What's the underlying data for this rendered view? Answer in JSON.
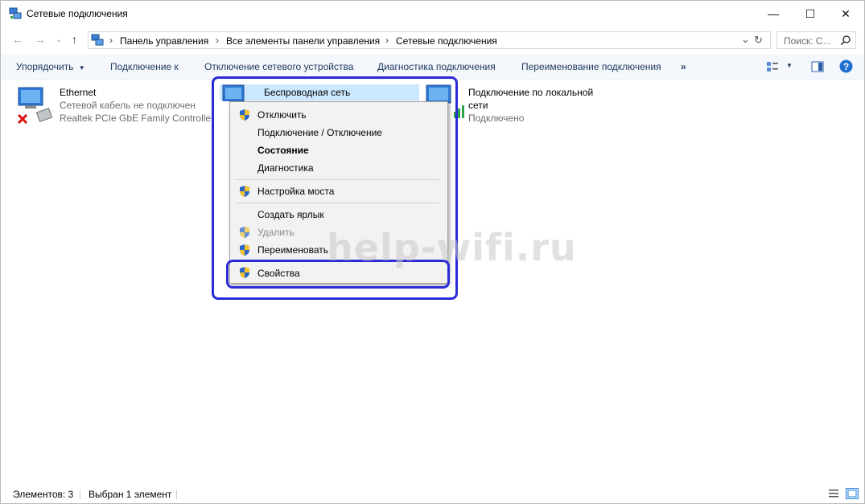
{
  "window": {
    "title": "Сетевые подключения",
    "controls": {
      "minimize": "—",
      "maximize": "☐",
      "close": "✕"
    }
  },
  "address": {
    "breadcrumbs": [
      "Панель управления",
      "Все элементы панели управления",
      "Сетевые подключения"
    ],
    "search_placeholder": "Поиск: С...",
    "nav_back": "←",
    "nav_forward": "→",
    "nav_up": "↑",
    "dropdown": "⌄",
    "refresh": "↻"
  },
  "toolbar": {
    "items": [
      "Упорядочить",
      "Подключение к",
      "Отключение сетевого устройства",
      "Диагностика подключения",
      "Переименование подключения"
    ],
    "more": "»"
  },
  "connections": [
    {
      "name": "Ethernet",
      "line1": "Сетевой кабель не подключен",
      "line2": "Realtek PCIe GbE Family Controller"
    },
    {
      "name": "Беспроводная сеть"
    },
    {
      "name": "Подключение по локальной",
      "name2": "сети",
      "line1": "Подключено"
    }
  ],
  "context_menu": {
    "items": [
      "Отключить",
      "Подключение / Отключение",
      "Состояние",
      "Диагностика",
      "Настройка моста",
      "Создать ярлык",
      "Удалить",
      "Переименовать",
      "Свойства"
    ]
  },
  "watermark": "help-wifi.ru",
  "status": {
    "count": "Элементов: 3",
    "selected": "Выбран 1 элемент"
  },
  "colors": {
    "accent": "#2a2ad6",
    "selection": "#cce8ff",
    "toolbar_text": "#1e395b"
  }
}
